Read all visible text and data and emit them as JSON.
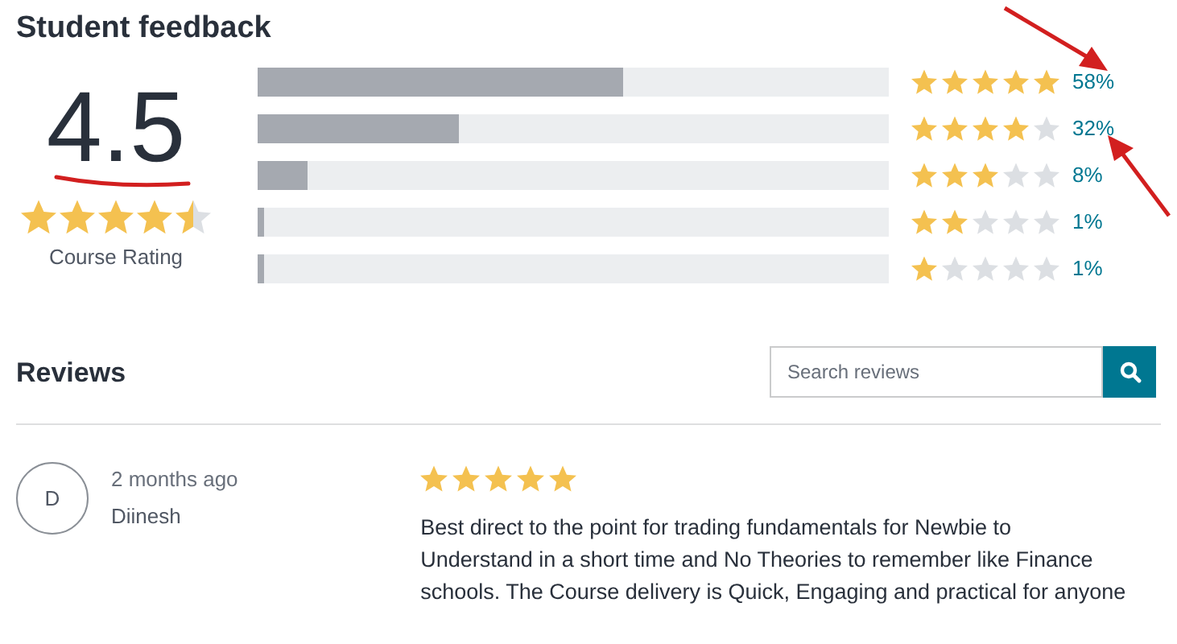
{
  "title": "Student feedback",
  "summary": {
    "rating": "4.5",
    "stars": 4.5,
    "label": "Course Rating"
  },
  "breakdown": [
    {
      "level": 0.58,
      "stars": 5,
      "percent": "58%"
    },
    {
      "level": 0.32,
      "stars": 4,
      "percent": "32%"
    },
    {
      "level": 0.08,
      "stars": 3,
      "percent": "8%"
    },
    {
      "level": 0.01,
      "stars": 2,
      "percent": "1%"
    },
    {
      "level": 0.01,
      "stars": 1,
      "percent": "1%"
    }
  ],
  "reviews_heading": "Reviews",
  "search": {
    "placeholder": "Search reviews"
  },
  "reviews": [
    {
      "initial": "D",
      "time": "2 months ago",
      "name": "Diinesh",
      "stars": 5,
      "text": "Best direct to the point for trading fundamentals for Newbie to Understand in a short time and No Theories to remember like Finance schools. The Course delivery is Quick, Engaging and practical for anyone"
    }
  ]
}
